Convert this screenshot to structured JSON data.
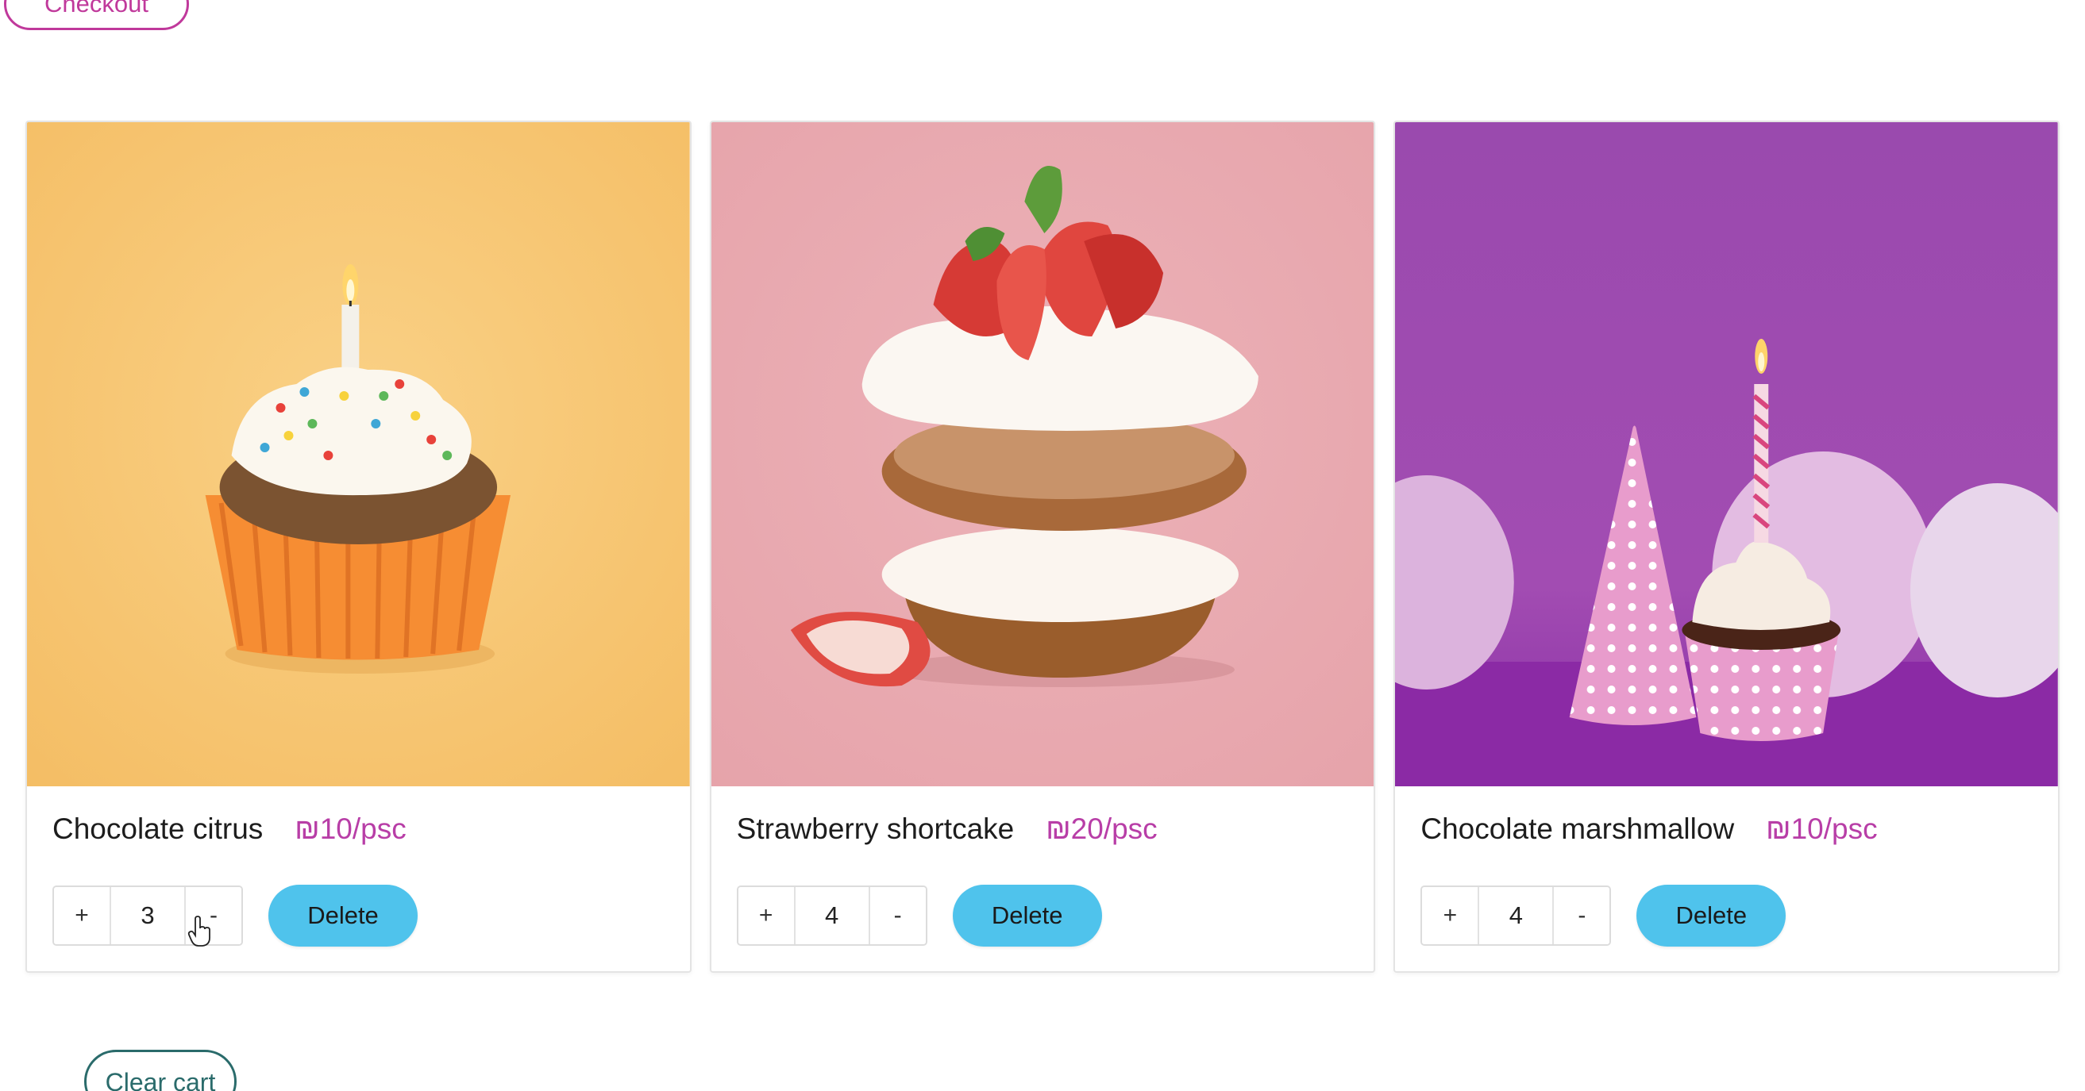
{
  "header": {
    "checkout_label": "Checkout"
  },
  "cart": {
    "items": [
      {
        "name": "Chocolate citrus",
        "price": "₪10/psc",
        "quantity": "3",
        "increment_label": "+",
        "decrement_label": "-",
        "delete_label": "Delete",
        "image_background": "#f7c56e"
      },
      {
        "name": "Strawberry shortcake",
        "price": "₪20/psc",
        "quantity": "4",
        "increment_label": "+",
        "decrement_label": "-",
        "delete_label": "Delete",
        "image_background": "#e8a9af"
      },
      {
        "name": "Chocolate marshmallow",
        "price": "₪10/psc",
        "quantity": "4",
        "increment_label": "+",
        "decrement_label": "-",
        "delete_label": "Delete",
        "image_background": "#9b46ad"
      }
    ],
    "clear_label": "Clear cart"
  },
  "colors": {
    "accent_pink": "#c0399b",
    "price_purple": "#b83ea7",
    "delete_blue": "#4fc3ec",
    "clear_teal": "#2a6b6b"
  }
}
